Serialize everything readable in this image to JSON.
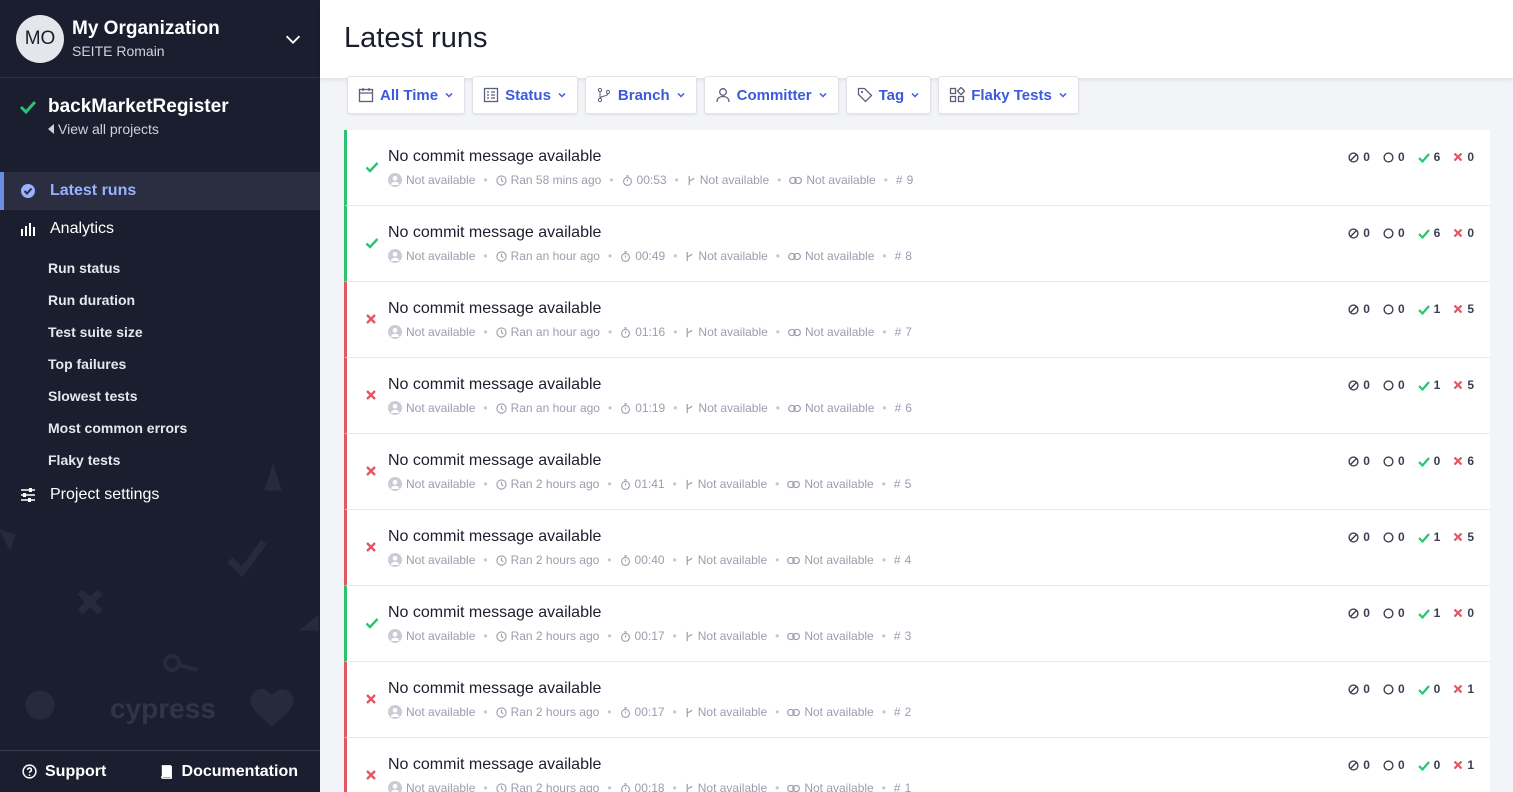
{
  "org": {
    "avatar": "MO",
    "name": "My Organization",
    "user": "SEITE Romain"
  },
  "project": {
    "name": "backMarketRegister",
    "view_all": "View all projects"
  },
  "nav": {
    "latest": "Latest runs",
    "analytics": "Analytics",
    "sub": [
      "Run status",
      "Run duration",
      "Test suite size",
      "Top failures",
      "Slowest tests",
      "Most common errors",
      "Flaky tests"
    ],
    "settings": "Project settings"
  },
  "footer": {
    "support": "Support",
    "docs": "Documentation"
  },
  "page": {
    "title": "Latest runs"
  },
  "filters": [
    "All Time",
    "Status",
    "Branch",
    "Committer",
    "Tag",
    "Flaky Tests"
  ],
  "colors": {
    "pass": "#2bc371",
    "fail": "#e15765",
    "accent": "#3b5bdb"
  },
  "runs": [
    {
      "status": "pass",
      "title": "No commit message available",
      "author": "Not available",
      "ran": "Ran 58 mins ago",
      "duration": "00:53",
      "branch": "Not available",
      "ci": "Not available",
      "num": "9",
      "skipped": "0",
      "pending": "0",
      "passed": "6",
      "failed": "0"
    },
    {
      "status": "pass",
      "title": "No commit message available",
      "author": "Not available",
      "ran": "Ran an hour ago",
      "duration": "00:49",
      "branch": "Not available",
      "ci": "Not available",
      "num": "8",
      "skipped": "0",
      "pending": "0",
      "passed": "6",
      "failed": "0"
    },
    {
      "status": "fail",
      "title": "No commit message available",
      "author": "Not available",
      "ran": "Ran an hour ago",
      "duration": "01:16",
      "branch": "Not available",
      "ci": "Not available",
      "num": "7",
      "skipped": "0",
      "pending": "0",
      "passed": "1",
      "failed": "5"
    },
    {
      "status": "fail",
      "title": "No commit message available",
      "author": "Not available",
      "ran": "Ran an hour ago",
      "duration": "01:19",
      "branch": "Not available",
      "ci": "Not available",
      "num": "6",
      "skipped": "0",
      "pending": "0",
      "passed": "1",
      "failed": "5"
    },
    {
      "status": "fail",
      "title": "No commit message available",
      "author": "Not available",
      "ran": "Ran 2 hours ago",
      "duration": "01:41",
      "branch": "Not available",
      "ci": "Not available",
      "num": "5",
      "skipped": "0",
      "pending": "0",
      "passed": "0",
      "failed": "6"
    },
    {
      "status": "fail",
      "title": "No commit message available",
      "author": "Not available",
      "ran": "Ran 2 hours ago",
      "duration": "00:40",
      "branch": "Not available",
      "ci": "Not available",
      "num": "4",
      "skipped": "0",
      "pending": "0",
      "passed": "1",
      "failed": "5"
    },
    {
      "status": "pass",
      "title": "No commit message available",
      "author": "Not available",
      "ran": "Ran 2 hours ago",
      "duration": "00:17",
      "branch": "Not available",
      "ci": "Not available",
      "num": "3",
      "skipped": "0",
      "pending": "0",
      "passed": "1",
      "failed": "0"
    },
    {
      "status": "fail",
      "title": "No commit message available",
      "author": "Not available",
      "ran": "Ran 2 hours ago",
      "duration": "00:17",
      "branch": "Not available",
      "ci": "Not available",
      "num": "2",
      "skipped": "0",
      "pending": "0",
      "passed": "0",
      "failed": "1"
    },
    {
      "status": "fail",
      "title": "No commit message available",
      "author": "Not available",
      "ran": "Ran 2 hours ago",
      "duration": "00:18",
      "branch": "Not available",
      "ci": "Not available",
      "num": "1",
      "skipped": "0",
      "pending": "0",
      "passed": "0",
      "failed": "1"
    }
  ]
}
